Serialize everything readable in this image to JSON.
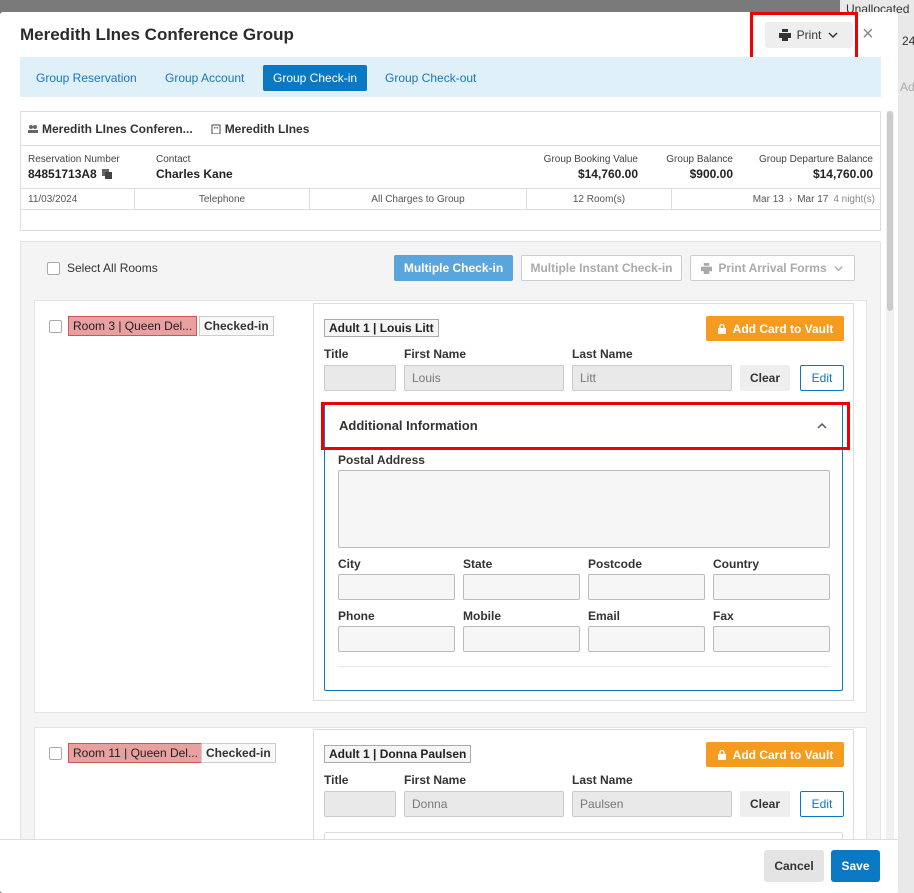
{
  "background": {
    "unallocated": "Unallocated",
    "number": "24",
    "add": "Add"
  },
  "modal": {
    "title": "Meredith LInes Conference Group",
    "print_label": "Print"
  },
  "tabs": [
    {
      "label": "Group Reservation"
    },
    {
      "label": "Group Account"
    },
    {
      "label": "Group Check-in"
    },
    {
      "label": "Group Check-out"
    }
  ],
  "active_tab": "Group Check-in",
  "summary": {
    "group_name": "Meredith LInes Conferen...",
    "company": "Meredith LInes",
    "reservation_number_label": "Reservation Number",
    "reservation_number": "84851713A8",
    "contact_label": "Contact",
    "contact": "Charles Kane",
    "booking_value_label": "Group Booking Value",
    "booking_value": "$14,760.00",
    "balance_label": "Group Balance",
    "balance": "$900.00",
    "departure_balance_label": "Group Departure Balance",
    "departure_balance": "$14,760.00",
    "date": "11/03/2024",
    "source": "Telephone",
    "charges": "All Charges to Group",
    "rooms": "12 Room(s)",
    "arrival": "Mar 13",
    "departure": "Mar 17",
    "nights": "4 night(s)"
  },
  "toolbar": {
    "select_all": "Select All Rooms",
    "multiple_checkin": "Multiple Check-in",
    "multiple_instant_checkin": "Multiple Instant Check-in",
    "print_arrival_forms": "Print Arrival Forms"
  },
  "rooms": [
    {
      "room": "Room 3 | Queen Del...",
      "status": "Checked-in",
      "guest_tag": "Adult 1 | Louis Litt",
      "add_card": "Add Card to Vault",
      "title_label": "Title",
      "first_name_label": "First Name",
      "last_name_label": "Last Name",
      "title": "",
      "first_name": "Louis",
      "last_name": "Litt",
      "clear": "Clear",
      "edit": "Edit",
      "additional": {
        "heading": "Additional Information",
        "postal_address": "Postal Address",
        "city": "City",
        "state": "State",
        "postcode": "Postcode",
        "country": "Country",
        "phone": "Phone",
        "mobile": "Mobile",
        "email": "Email",
        "fax": "Fax"
      }
    },
    {
      "room": "Room 11 | Queen Del...",
      "status": "Checked-in",
      "guest_tag": "Adult 1 | Donna Paulsen",
      "add_card": "Add Card to Vault",
      "title_label": "Title",
      "first_name_label": "First Name",
      "last_name_label": "Last Name",
      "title": "",
      "first_name": "Donna",
      "last_name": "Paulsen",
      "clear": "Clear",
      "edit": "Edit"
    }
  ],
  "footer": {
    "cancel": "Cancel",
    "save": "Save"
  }
}
